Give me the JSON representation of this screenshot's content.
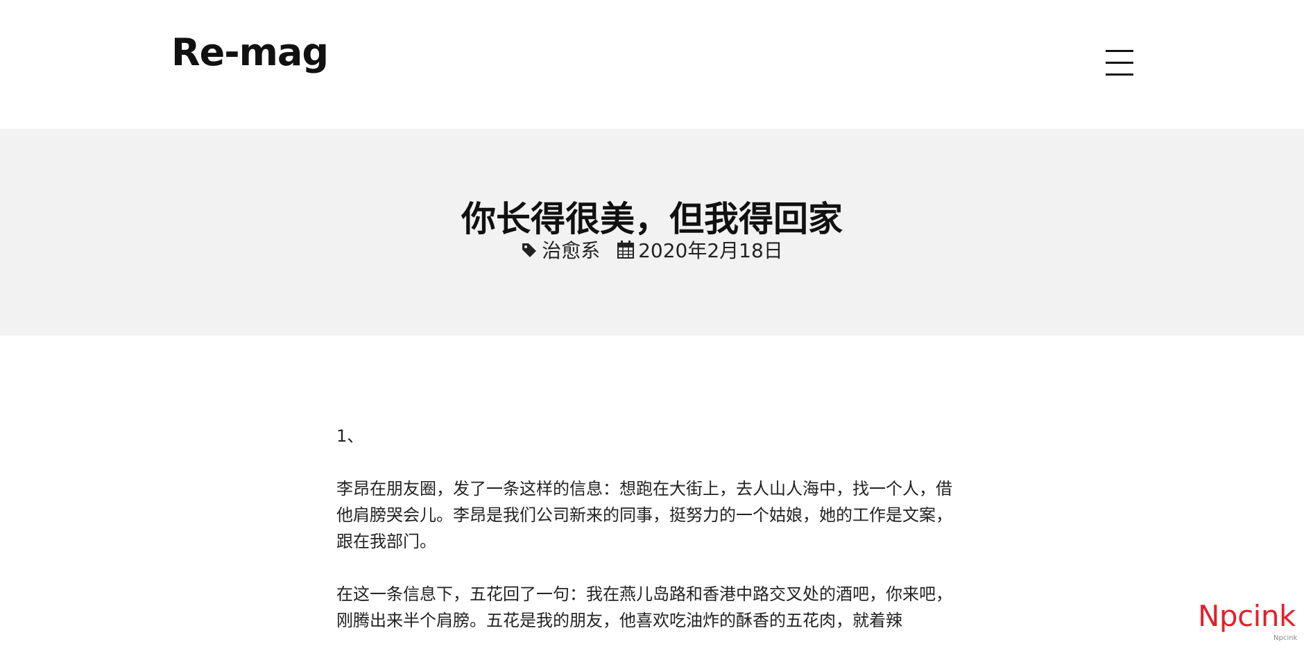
{
  "site": {
    "title": "Re-mag"
  },
  "post": {
    "title": "你长得很美，但我得回家",
    "category": "治愈系",
    "date": "2020年2月18日",
    "paragraphs": [
      "1、",
      "李昂在朋友圈，发了一条这样的信息：想跑在大街上，去人山人海中，找一个人，借他肩膀哭会儿。李昂是我们公司新来的同事，挺努力的一个姑娘，她的工作是文案，跟在我部门。",
      "在这一条信息下，五花回了一句：我在燕儿岛路和香港中路交叉处的酒吧，你来吧，刚腾出来半个肩膀。五花是我的朋友，他喜欢吃油炸的酥香的五花肉，就着辣"
    ]
  },
  "watermark": {
    "brand": "Npcink",
    "small": "Npcink"
  },
  "icons": {
    "menu": "hamburger-icon",
    "category": "tag-icon",
    "date": "calendar-icon"
  }
}
